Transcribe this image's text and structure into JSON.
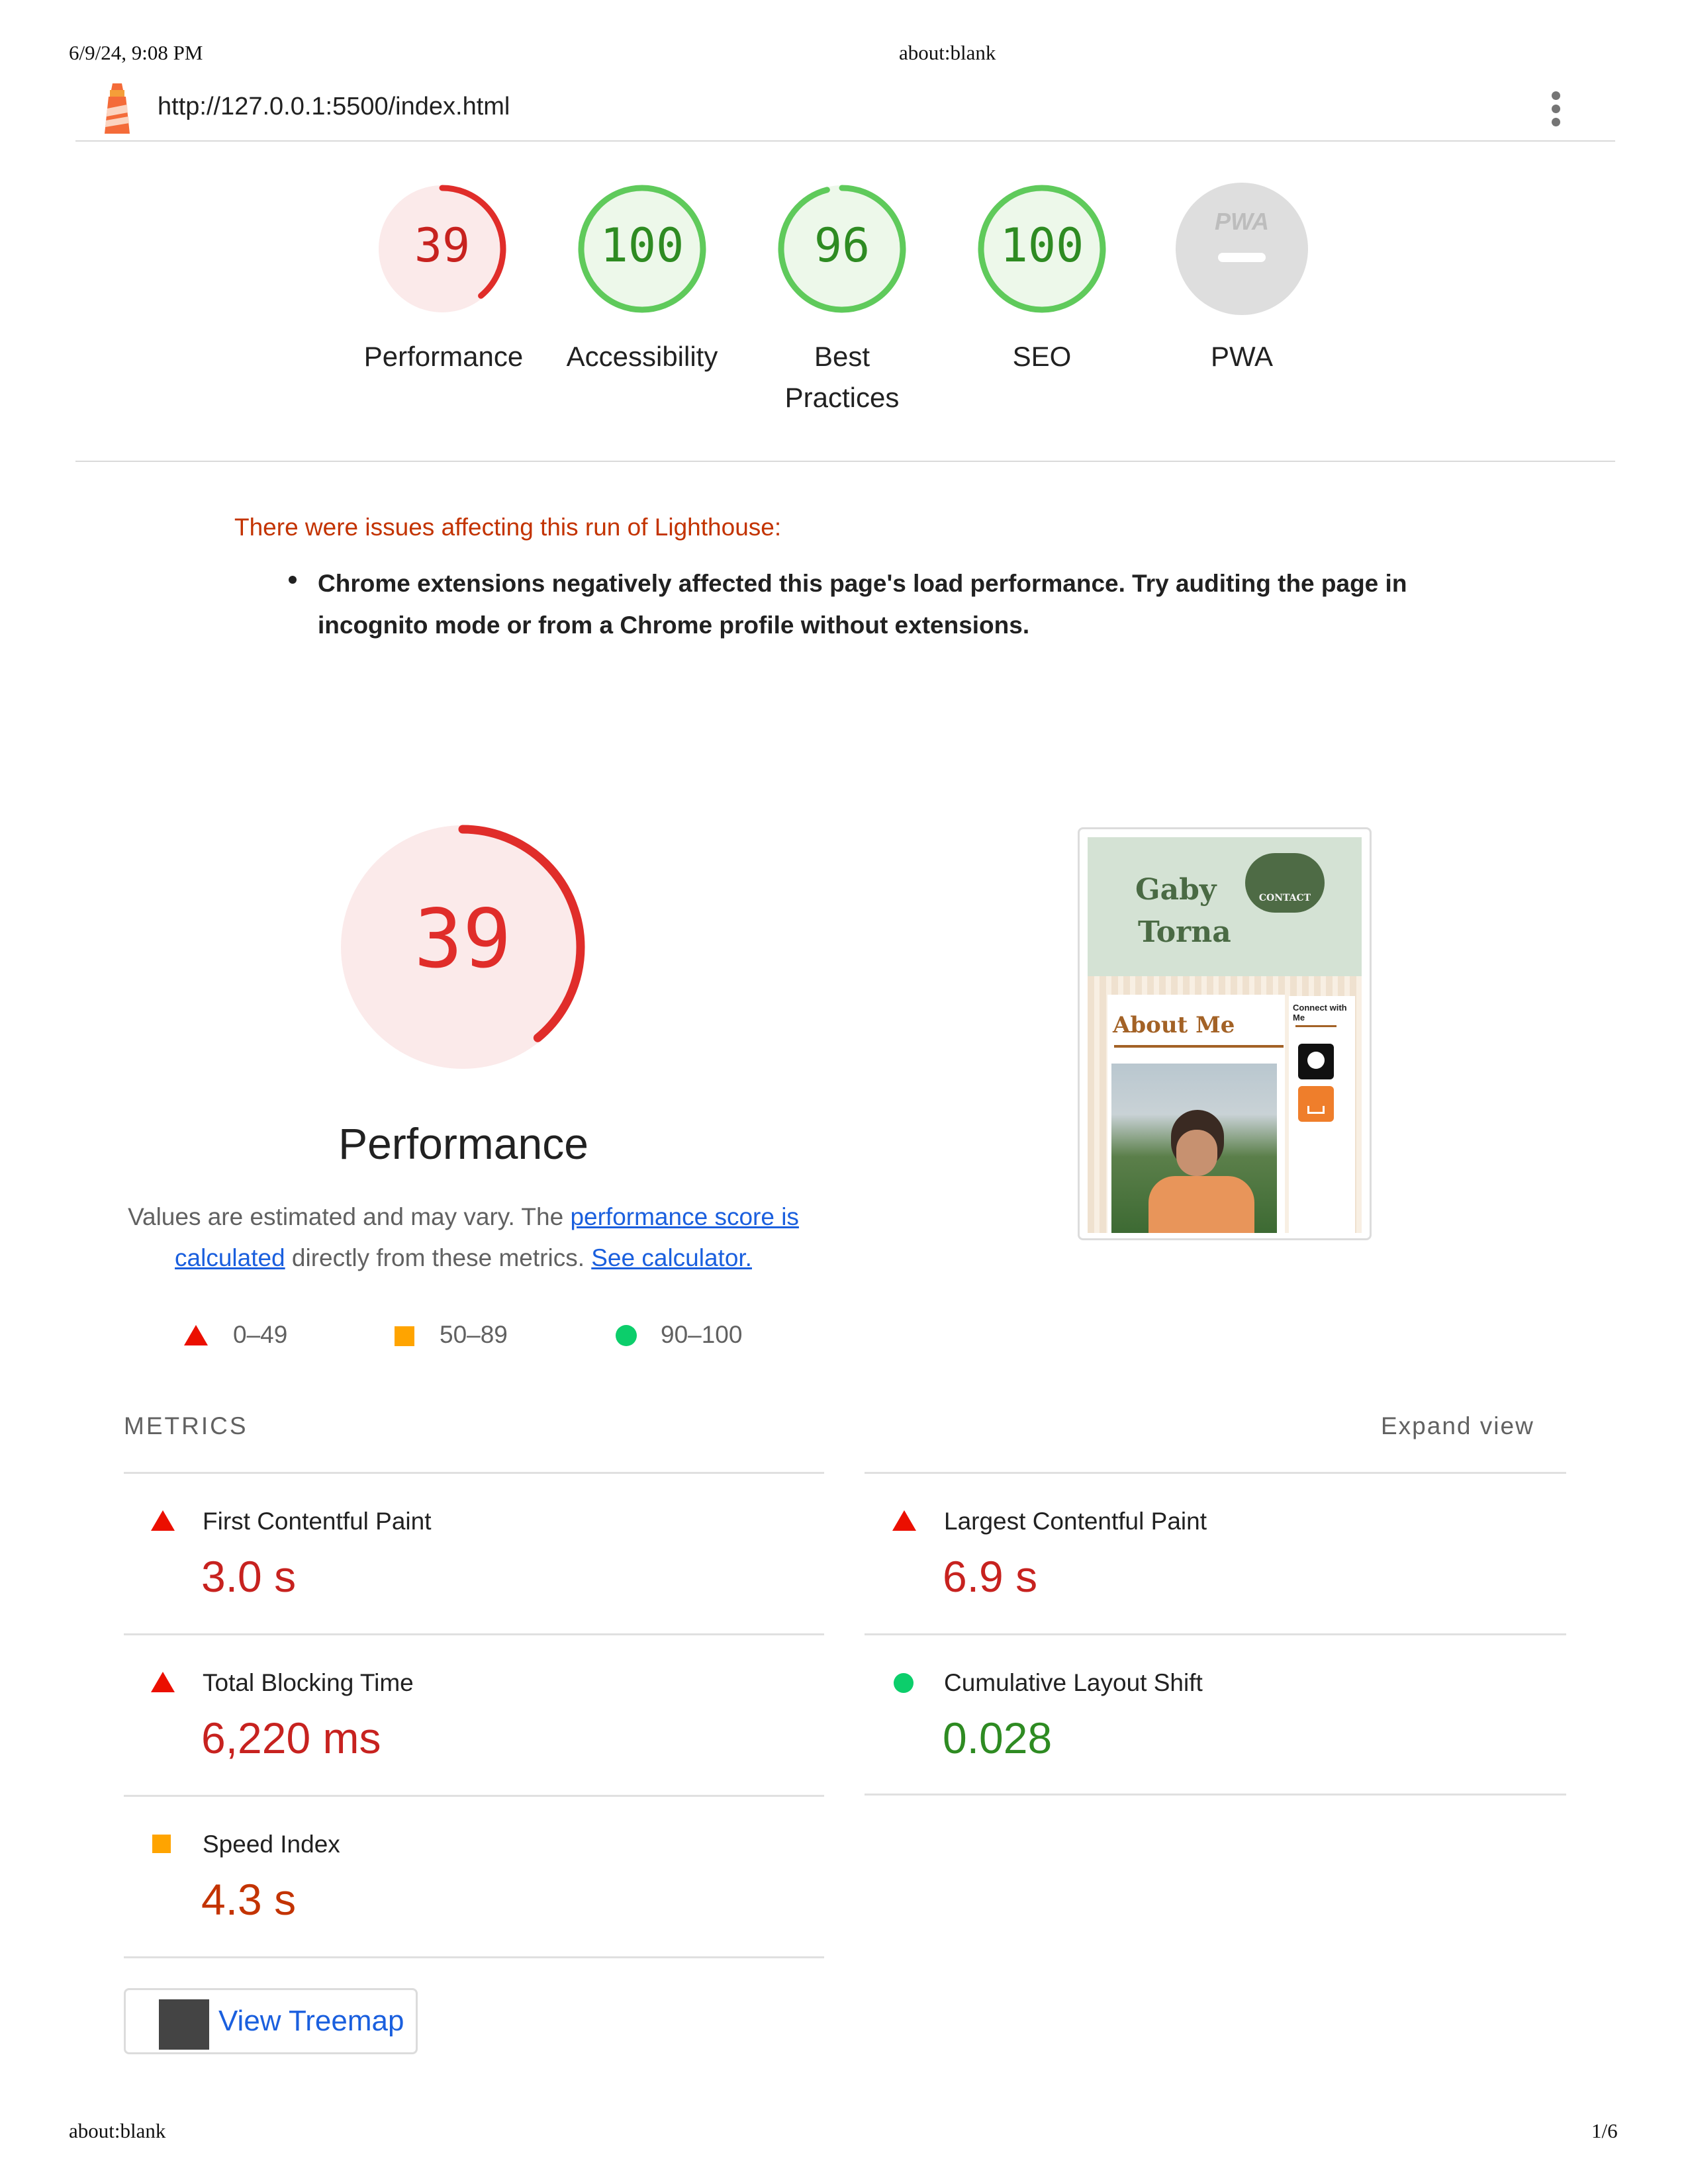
{
  "print_header": {
    "datetime": "6/9/24, 9:08 PM",
    "title": "about:blank"
  },
  "print_footer": {
    "left": "about:blank",
    "right": "1/6"
  },
  "topbar": {
    "url": "http://127.0.0.1:5500/index.html",
    "menu_icon": "kebab-menu-icon",
    "logo_icon": "lighthouse-icon"
  },
  "gauges": [
    {
      "label": "Performance",
      "score": "39",
      "fraction": 0.39,
      "status": "fail"
    },
    {
      "label": "Accessibility",
      "score": "100",
      "fraction": 1.0,
      "status": "pass"
    },
    {
      "label": "Best",
      "label2": "Practices",
      "score": "96",
      "fraction": 0.96,
      "status": "pass"
    },
    {
      "label": "SEO",
      "score": "100",
      "fraction": 1.0,
      "status": "pass"
    },
    {
      "label": "PWA",
      "badge": "PWA",
      "status": "na"
    }
  ],
  "warnings": {
    "title": "There were issues affecting this run of Lighthouse:",
    "items": [
      "Chrome extensions negatively affected this page's load performance. Try auditing the page in incognito mode or from a Chrome profile without extensions."
    ]
  },
  "performance": {
    "score": "39",
    "fraction": 0.39,
    "title": "Performance",
    "desc_prefix": "Values are estimated and may vary. The ",
    "link1": "performance score is calculated",
    "desc_mid": " directly from these metrics. ",
    "link2": "See calculator.",
    "legend": [
      "0–49",
      "50–89",
      "90–100"
    ]
  },
  "screenshot": {
    "name_line1": "Gaby",
    "name_line2": "Torna",
    "nav_label": "CONTACT",
    "about": "About Me",
    "connect": "Connect with Me"
  },
  "metrics": {
    "header": "METRICS",
    "expand": "Expand view",
    "items": [
      {
        "label": "First Contentful Paint",
        "value": "3.0 s",
        "status": "fail"
      },
      {
        "label": "Largest Contentful Paint",
        "value": "6.9 s",
        "status": "fail"
      },
      {
        "label": "Total Blocking Time",
        "value": "6,220 ms",
        "status": "fail"
      },
      {
        "label": "Cumulative Layout Shift",
        "value": "0.028",
        "status": "pass"
      },
      {
        "label": "Speed Index",
        "value": "4.3 s",
        "status": "average"
      }
    ]
  },
  "treemap": {
    "label": "View Treemap"
  },
  "colors": {
    "fail": "#c7221f",
    "average": "#c33300",
    "pass": "#0b8043",
    "link": "#1a5fde"
  }
}
